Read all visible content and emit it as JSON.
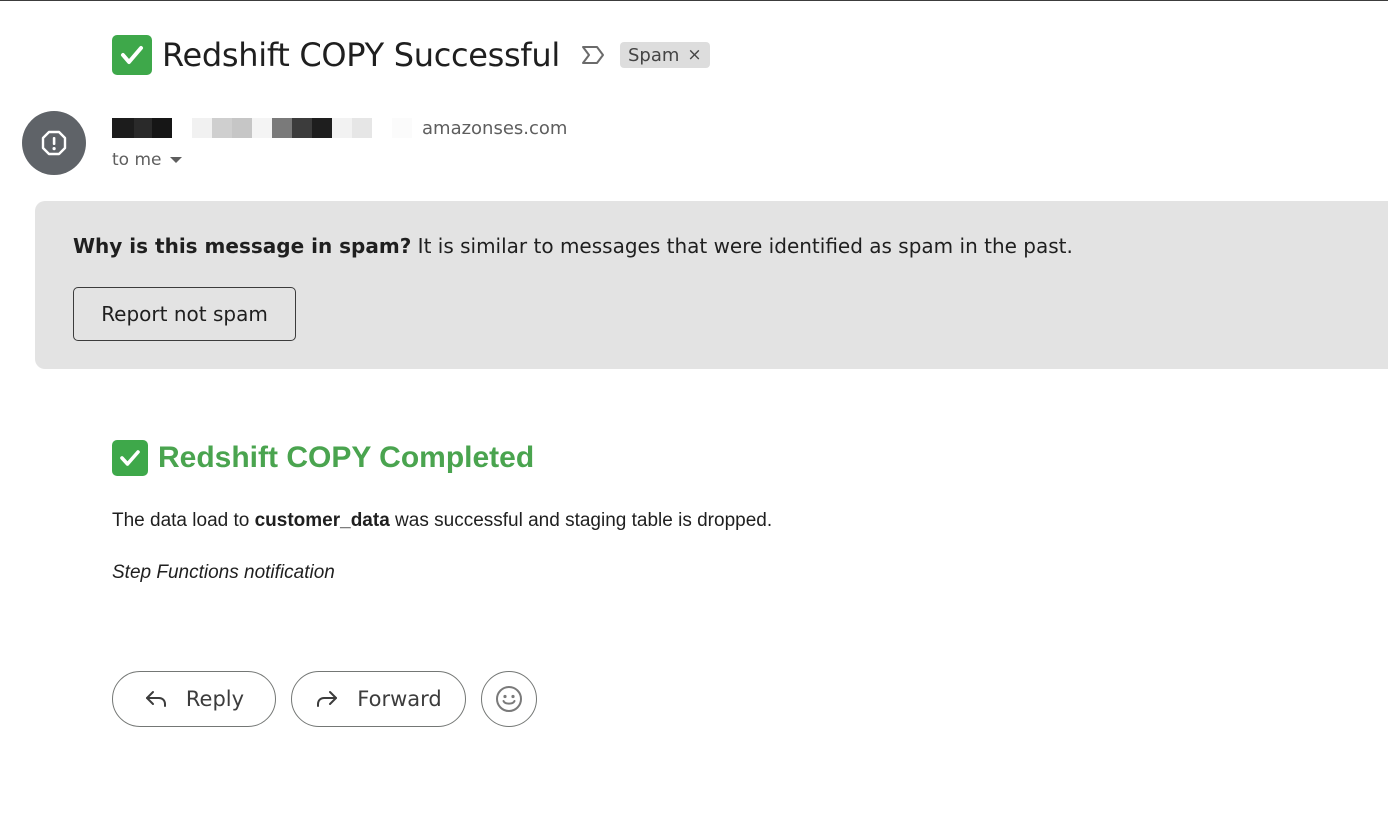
{
  "email": {
    "subject": "Redshift COPY Successful",
    "label_chip": "Spam",
    "chip_remove": "×",
    "sender_domain": "amazonses.com",
    "recipient": "to me"
  },
  "spam_banner": {
    "question": "Why is this message in spam?",
    "explanation": " It is similar to messages that were identified as spam in the past.",
    "button_label": "Report not spam"
  },
  "body": {
    "heading": "Redshift COPY Completed",
    "line_prefix": "The data load to ",
    "table_name": "customer_data",
    "line_suffix": " was successful and staging table is dropped.",
    "note": "Step Functions notification"
  },
  "actions": {
    "reply_label": "Reply",
    "forward_label": "Forward"
  },
  "icons": {
    "subject_emoji": "check-mark-button-icon",
    "importance": "important-marker-icon",
    "avatar": "spam-warning-icon",
    "reply": "reply-arrow-icon",
    "forward": "forward-arrow-icon",
    "emoji_reaction": "smiley-icon"
  },
  "colors": {
    "heading_green": "#4aa44f",
    "check_green": "#3ea84a",
    "banner_bg": "#e3e3e3",
    "avatar_bg": "#5f6368"
  }
}
